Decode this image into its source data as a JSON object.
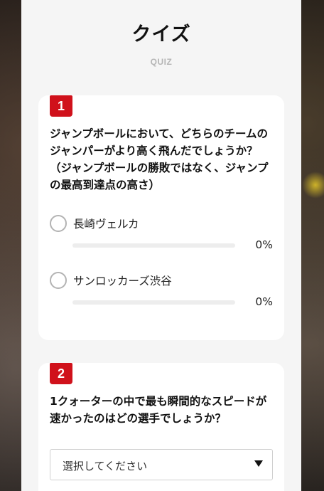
{
  "header": {
    "title": "クイズ",
    "subtitle": "QUIZ"
  },
  "questions": [
    {
      "number": "1",
      "text": "ジャンプボールにおいて、どちらのチームのジャンパーがより高く飛んだでしょうか？（ジャンプボールの勝敗ではなく、ジャンプの最高到達点の高さ）",
      "options": [
        {
          "label": "長崎ヴェルカ",
          "percent_label": "0%",
          "percent": 0
        },
        {
          "label": "サンロッカーズ渋谷",
          "percent_label": "0%",
          "percent": 0
        }
      ]
    },
    {
      "number": "2",
      "text": "1クォーターの中で最も瞬間的なスピードが速かったのはどの選手でしょうか？",
      "select": {
        "value": "選択してください"
      }
    }
  ],
  "colors": {
    "accent": "#d0111b",
    "panel": "#f5f5f5",
    "card": "#ffffff"
  },
  "icons": {
    "radio": "radio-unchecked-icon",
    "dropdown": "caret-down-icon"
  }
}
